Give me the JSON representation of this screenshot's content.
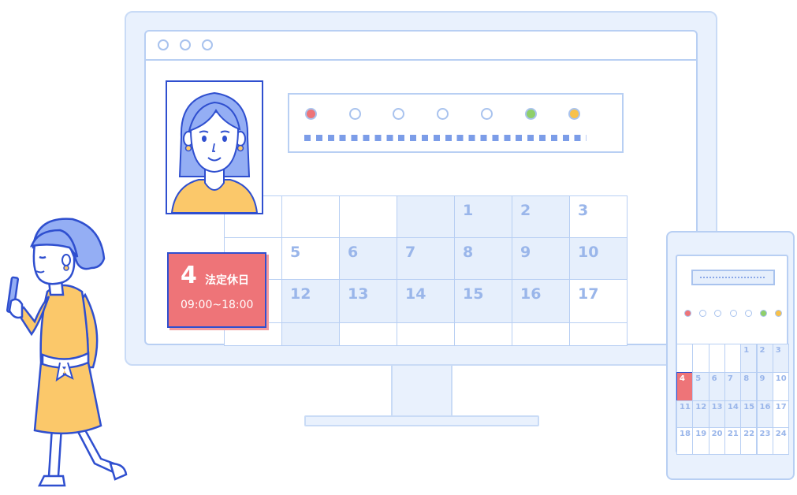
{
  "colors": {
    "outline": "#2f4fcf",
    "line_light": "#b8cff3",
    "fill_light": "#e9f1fd",
    "shade": "#e6effc",
    "event_red": "#ee7478",
    "dot_red": "#ee7478",
    "dot_green": "#8fcf6a",
    "dot_yellow": "#f8c14a",
    "dress_yellow": "#fbc86a",
    "hair_blue": "#94aef4",
    "number_blue": "#9ab6ea"
  },
  "monitor": {
    "window_controls": [
      "close-dot",
      "minimize-dot",
      "maximize-dot"
    ],
    "status_dots": [
      "red",
      "empty",
      "empty",
      "empty",
      "empty",
      "green",
      "yellow"
    ],
    "calendar": {
      "row1": [
        "",
        "",
        "",
        "1",
        "2",
        "3"
      ],
      "row2": [
        "5",
        "6",
        "7",
        "8",
        "9",
        "10"
      ],
      "row3": [
        "12",
        "13",
        "14",
        "15",
        "16",
        "17"
      ]
    },
    "event": {
      "day": "4",
      "title": "法定休日",
      "time": "09:00~18:00"
    }
  },
  "phone": {
    "status_dots": [
      "red",
      "empty",
      "empty",
      "empty",
      "empty",
      "green",
      "yellow"
    ],
    "calendar": [
      [
        "",
        "",
        "",
        "",
        "1",
        "2",
        "3"
      ],
      [
        "4",
        "5",
        "6",
        "7",
        "8",
        "9",
        "10"
      ],
      [
        "11",
        "12",
        "13",
        "14",
        "15",
        "16",
        "17"
      ],
      [
        "18",
        "19",
        "20",
        "21",
        "22",
        "23",
        "24"
      ]
    ],
    "highlight_day": "4"
  },
  "icons": {
    "profile": "woman-portrait-icon",
    "user": "woman-with-phone-illustration"
  }
}
